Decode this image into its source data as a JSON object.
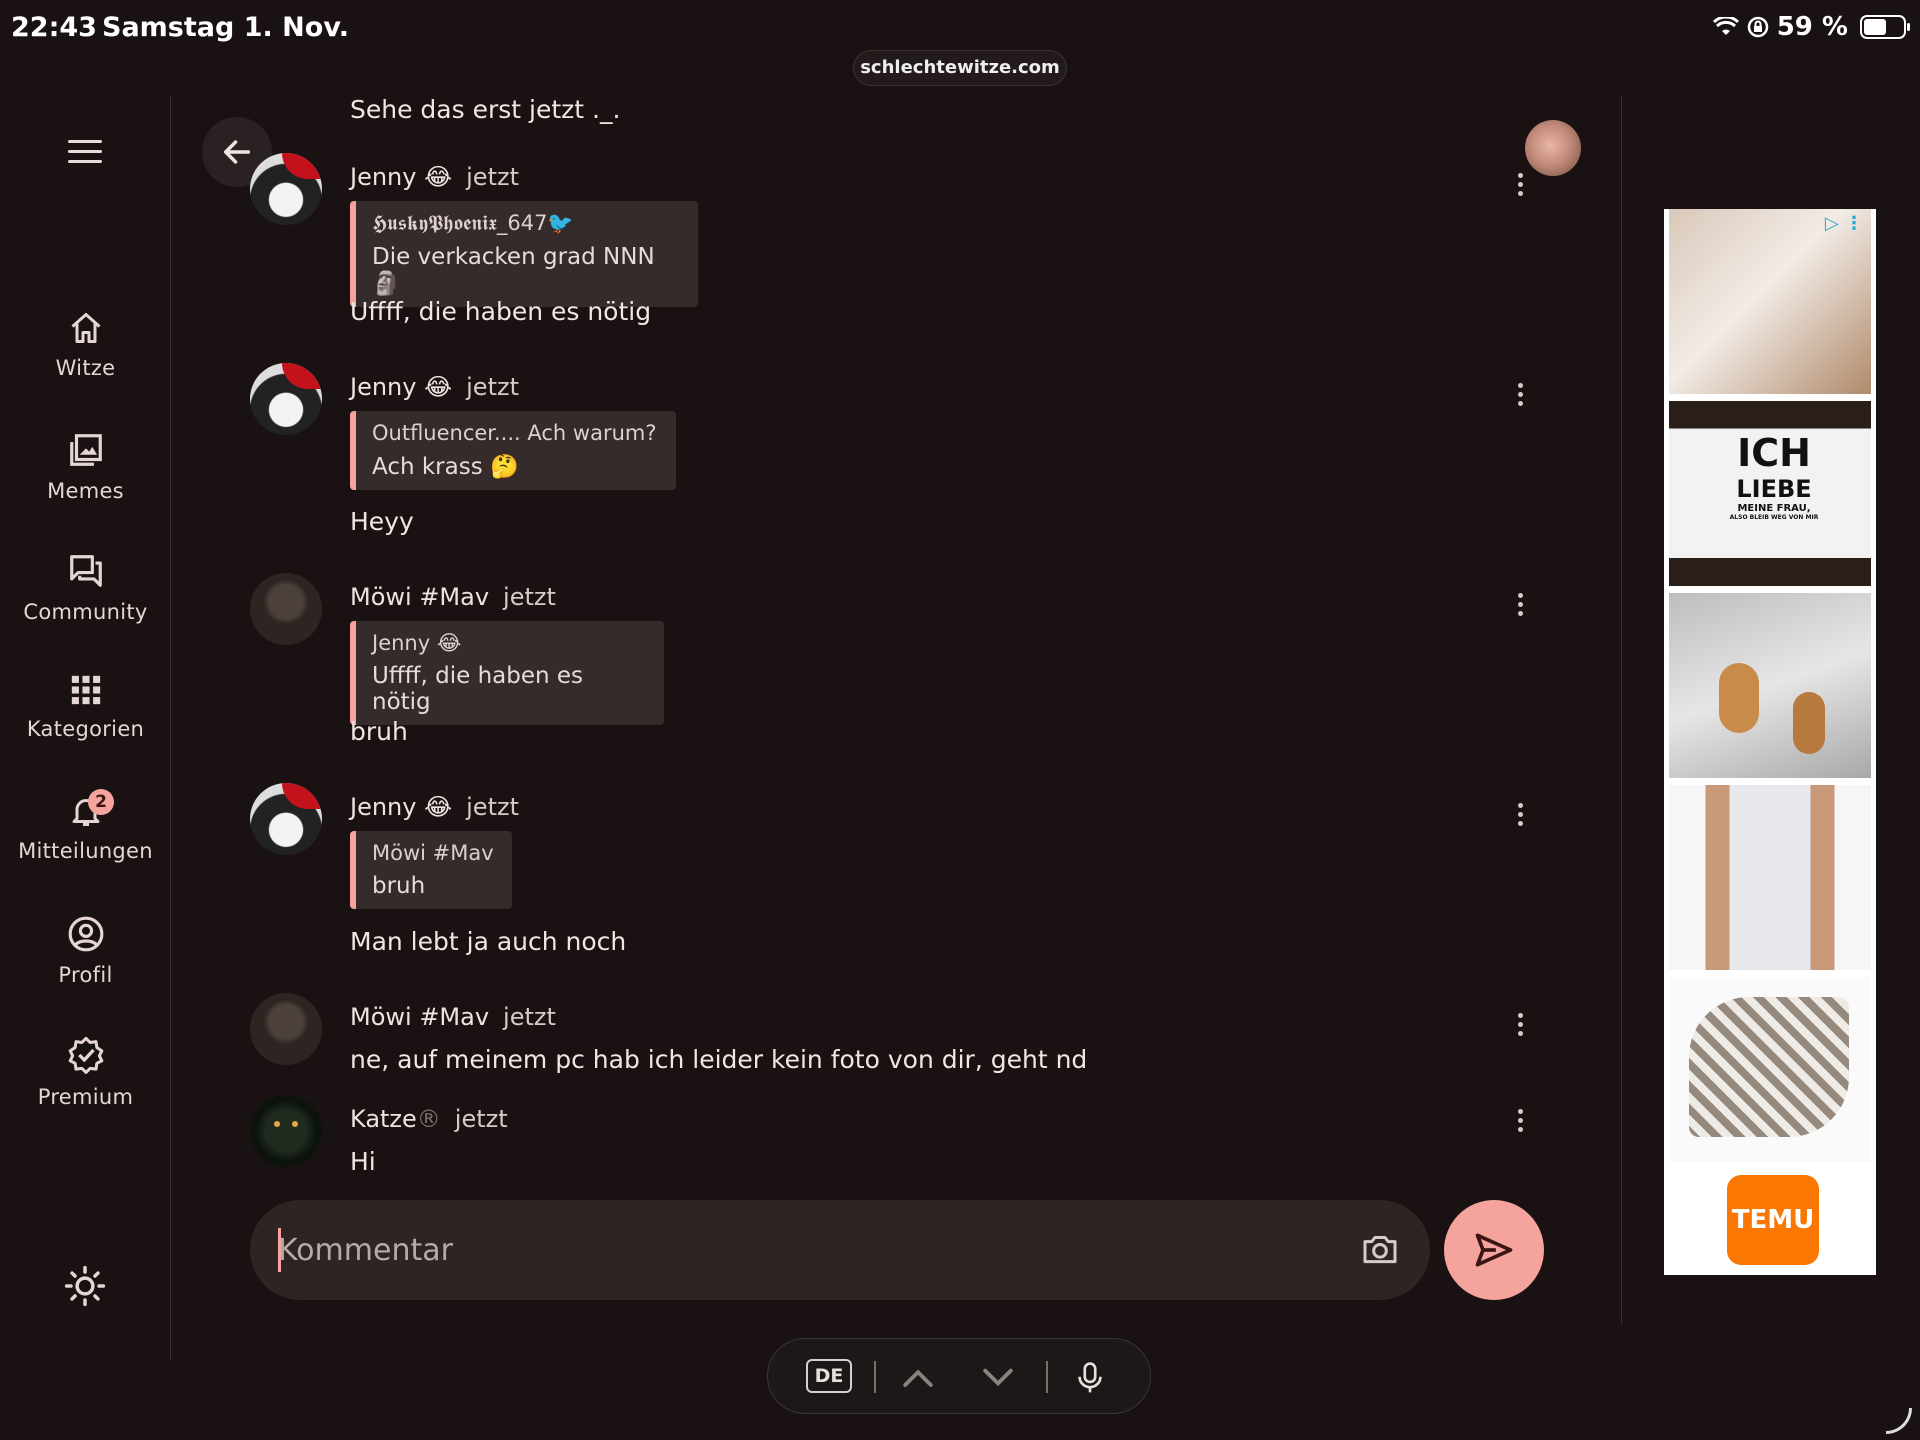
{
  "status_bar": {
    "time": "22:43",
    "date": "Samstag 1. Nov.",
    "battery": "59 %",
    "battery_level": 0.59
  },
  "browser": {
    "url": "schlechtewitze.com"
  },
  "sidebar": {
    "items": [
      {
        "label": "Witze",
        "icon": "home-icon"
      },
      {
        "label": "Memes",
        "icon": "images-icon"
      },
      {
        "label": "Community",
        "icon": "forum-icon"
      },
      {
        "label": "Kategorien",
        "icon": "grid-icon"
      },
      {
        "label": "Mitteilungen",
        "icon": "bell-icon",
        "badge": "2"
      },
      {
        "label": "Profil",
        "icon": "account-circle-icon"
      },
      {
        "label": "Premium",
        "icon": "verified-badge-icon"
      }
    ]
  },
  "chat": {
    "prev_body": "Sehe das erst jetzt ._.",
    "comments": [
      {
        "author": "Jenny 😂",
        "time": "jetzt",
        "quote_author": "𝕳𝖚𝖘𝖐𝖞𝕻𝖍𝖔𝖊𝖓𝖎𝖝_647🐦",
        "quote_text": "Die verkacken grad NNN 🗿",
        "body": "Uffff, die haben es nötig"
      },
      {
        "author": "Jenny 😂",
        "time": "jetzt",
        "quote_author": "Outfluencer.... Ach warum?",
        "quote_text": "Ach krass 🤔",
        "body": "Heyy"
      },
      {
        "author": "Möwi #Mav",
        "time": "jetzt",
        "quote_author": "Jenny 😂",
        "quote_text": "Uffff, die haben es nötig",
        "body": "bruh"
      },
      {
        "author": "Jenny 😂",
        "time": "jetzt",
        "quote_author": "Möwi #Mav",
        "quote_text": "bruh",
        "body": "Man lebt ja auch noch"
      },
      {
        "author": "Möwi #Mav",
        "time": "jetzt",
        "body": "ne, auf meinem pc hab ich leider kein foto von dir, geht nd"
      },
      {
        "author": "Katze",
        "author_mark": "®",
        "time": "jetzt",
        "body": "Hi"
      }
    ]
  },
  "composer": {
    "placeholder": "Kommentar"
  },
  "ads": {
    "shirt_line1": "ICH",
    "shirt_line2": "LIEBE",
    "shirt_line3": "MEINE FRAU,",
    "shirt_line4": "ALSO BLEIB WEG VON MIR",
    "brand": "TEMU"
  },
  "keyboard_bar": {
    "lang": "DE"
  }
}
